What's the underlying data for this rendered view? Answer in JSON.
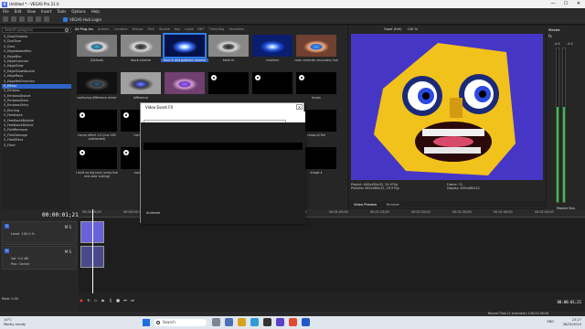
{
  "window": {
    "title": "Untitled * - VEGAS Pro 21.0",
    "minimize": "—",
    "maximize": "☐",
    "close": "✕"
  },
  "menu": [
    "File",
    "Edit",
    "View",
    "Insert",
    "Tools",
    "Options",
    "Help"
  ],
  "toolbar": {
    "hub_label": "VEGAS Hub Login"
  },
  "fx_browser": {
    "search_placeholder": "Search plug-ins",
    "tabs": [
      "All Plug-Ins",
      "Artistic",
      "Creative",
      "Distort",
      "Film",
      "Stylize",
      "Key",
      "Light",
      "RBT",
      "Time/Seq",
      "Favorites"
    ],
    "active_tab": "All Plug-Ins",
    "list": [
      "S_DropShadow",
      "S_DuoTone",
      "S_Dust",
      "S_EdgeAwareBlur",
      "S_EdgeBlur",
      "S_EdgeColorize",
      "S_EdgeGlow",
      "S_EdgeGlowDouble",
      "S_EdgeRays",
      "S_EdgeRelDirection",
      "S_Effect",
      "S_Emboss",
      "S_EmbossDistort",
      "S_EmbossGlass",
      "S_EmbossShiny",
      "S_Etching",
      "S_Feedback",
      "S_FeedbackBubble",
      "S_FeedbackDistort",
      "S_FieldRemove",
      "S_FilmDamage",
      "S_FilmEffect",
      "S_Flare"
    ],
    "selected_item": "S_Effect",
    "thumbs": [
      {
        "caption": "(Default)",
        "style": "eye"
      },
      {
        "caption": "black colorize",
        "style": "eye bw"
      },
      {
        "caption": "blue in and gradient colorize",
        "style": "eye glow"
      },
      {
        "caption": "black fx",
        "style": "eye bw"
      },
      {
        "caption": "inverted",
        "style": "eye blue"
      },
      {
        "caption": "color corrector secondary hue",
        "style": "eye color"
      },
      {
        "caption": "confusing difference mirror",
        "style": "eye dark"
      },
      {
        "caption": "difference",
        "style": "eye neg"
      },
      {
        "caption": "",
        "style": "eye pink"
      },
      {
        "caption": "",
        "style": "black"
      },
      {
        "caption": "",
        "style": "black"
      },
      {
        "caption": "fusion",
        "style": "black"
      },
      {
        "caption": "horror effect 1.0 (hue 180 subtracted)",
        "style": "black"
      },
      {
        "caption": "horror eff",
        "style": "black"
      },
      {
        "caption": "",
        "style": "black"
      },
      {
        "caption": "",
        "style": "black"
      },
      {
        "caption": "",
        "style": "black"
      },
      {
        "caption": "chaos of fire",
        "style": "black"
      },
      {
        "caption": "I built no big (only using hue and color scaling)",
        "style": "black"
      },
      {
        "caption": "swden m",
        "style": "black"
      },
      {
        "caption": "",
        "style": "black"
      },
      {
        "caption": "",
        "style": "black"
      },
      {
        "caption": "",
        "style": "black"
      },
      {
        "caption": "image 4",
        "style": "black"
      }
    ],
    "info": "S_Effect: OFX, 32-bit floating point, Grouping: Sapphire Builder, Version 1.17020"
  },
  "bottom_tabs": [
    "VEGAS Hub",
    "Hub Explorer",
    "Project Media",
    "Explorer",
    "Video FX",
    "Transitions"
  ],
  "preview": {
    "quality": "Good (Full)",
    "zoom": "100 %",
    "project": "Project:  640x480x32, 29.970p",
    "preview_res": "Preview:  640x480x32, 29.970p",
    "display": "Display:  640x480x32",
    "frame": "Frame:  31",
    "tabs": [
      "Video Preview",
      "Trimmer"
    ]
  },
  "master": {
    "title": "Master",
    "fx": "fx",
    "left": "-4.4",
    "right": "-4.4",
    "footer": "Master Bus",
    "level_fraction": 0.62
  },
  "dialog": {
    "title": "Video Event FX",
    "close": "✕",
    "tab_label": "Animate"
  },
  "timeline": {
    "time": "00:00:01;21",
    "ruler": [
      "00:00:00;00",
      "00:00:10;00",
      "00:00:20;00",
      "00:00:30;00",
      "00:00:40;00",
      "00:00:50;00",
      "00:01:00;00",
      "00:01:10;00",
      "00:01:20;00",
      "00:01:30;00",
      "00:01:40;00",
      "00:01:50;00"
    ],
    "video_track": {
      "num": "1",
      "ms": "M S",
      "level": "Level:  100.0 %"
    },
    "audio_track": {
      "num": "2",
      "ms": "M S",
      "vol": "Vol:     0.0 dB",
      "pan": "Pan:      Center"
    },
    "rate": "Rate: 0.00",
    "end_time": "00:00:01;21"
  },
  "status": {
    "record_time": "Record Time (2 channels): 140:51:38:26"
  },
  "taskbar": {
    "weather_temp": "14°C",
    "weather_desc": "Mostly cloudy",
    "search_label": "Search",
    "lang": "ENG",
    "time": "23:27",
    "date": "28/02/2024"
  },
  "colors": {
    "accent": "#2f65c8",
    "preview_bg": "#4a3cc8"
  }
}
